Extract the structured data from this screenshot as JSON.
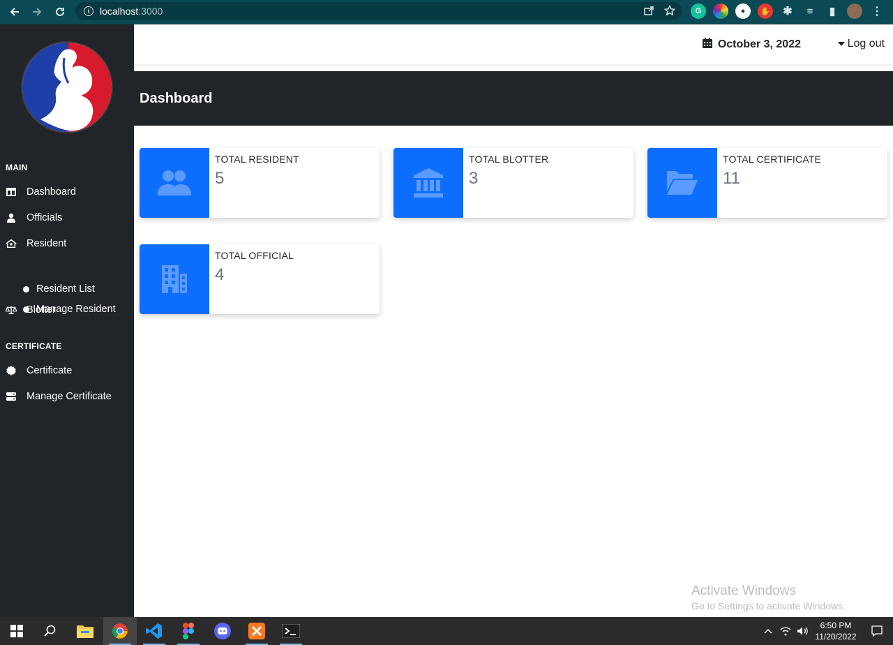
{
  "browser": {
    "url_host": "localhost",
    "url_port": ":3000"
  },
  "sidebar": {
    "section_main": "MAIN",
    "section_certificate": "CERTIFICATE",
    "items": [
      {
        "label": "Dashboard",
        "icon": "table-columns-icon"
      },
      {
        "label": "Officials",
        "icon": "user-tie-icon"
      },
      {
        "label": "Resident",
        "icon": "house-user-icon"
      },
      {
        "label": "Resident List",
        "icon": "dot"
      },
      {
        "label": "Manage Resident",
        "icon": "dot"
      },
      {
        "label": "Blotter",
        "icon": "scale-balanced-icon"
      },
      {
        "label": "Certificate",
        "icon": "certificate-icon"
      },
      {
        "label": "Manage Certificate",
        "icon": "server-icon"
      }
    ]
  },
  "header": {
    "date": "October 3, 2022",
    "logout": "Log out"
  },
  "page": {
    "title": "Dashboard"
  },
  "cards": [
    {
      "label": "TOTAL RESIDENT",
      "value": "5",
      "icon": "users-icon"
    },
    {
      "label": "TOTAL BLOTTER",
      "value": "3",
      "icon": "landmark-icon"
    },
    {
      "label": "TOTAL CERTIFICATE",
      "value": "11",
      "icon": "folder-open-icon"
    },
    {
      "label": "TOTAL OFFICIAL",
      "value": "4",
      "icon": "building-icon"
    }
  ],
  "watermark": {
    "title": "Activate Windows",
    "subtitle": "Go to Settings to activate Windows."
  },
  "taskbar": {
    "time": "6:50 PM",
    "date": "11/20/2022"
  },
  "colors": {
    "accent": "#0d6efd",
    "sidebar_bg": "#212529",
    "browser_bar": "#0b4a55"
  }
}
